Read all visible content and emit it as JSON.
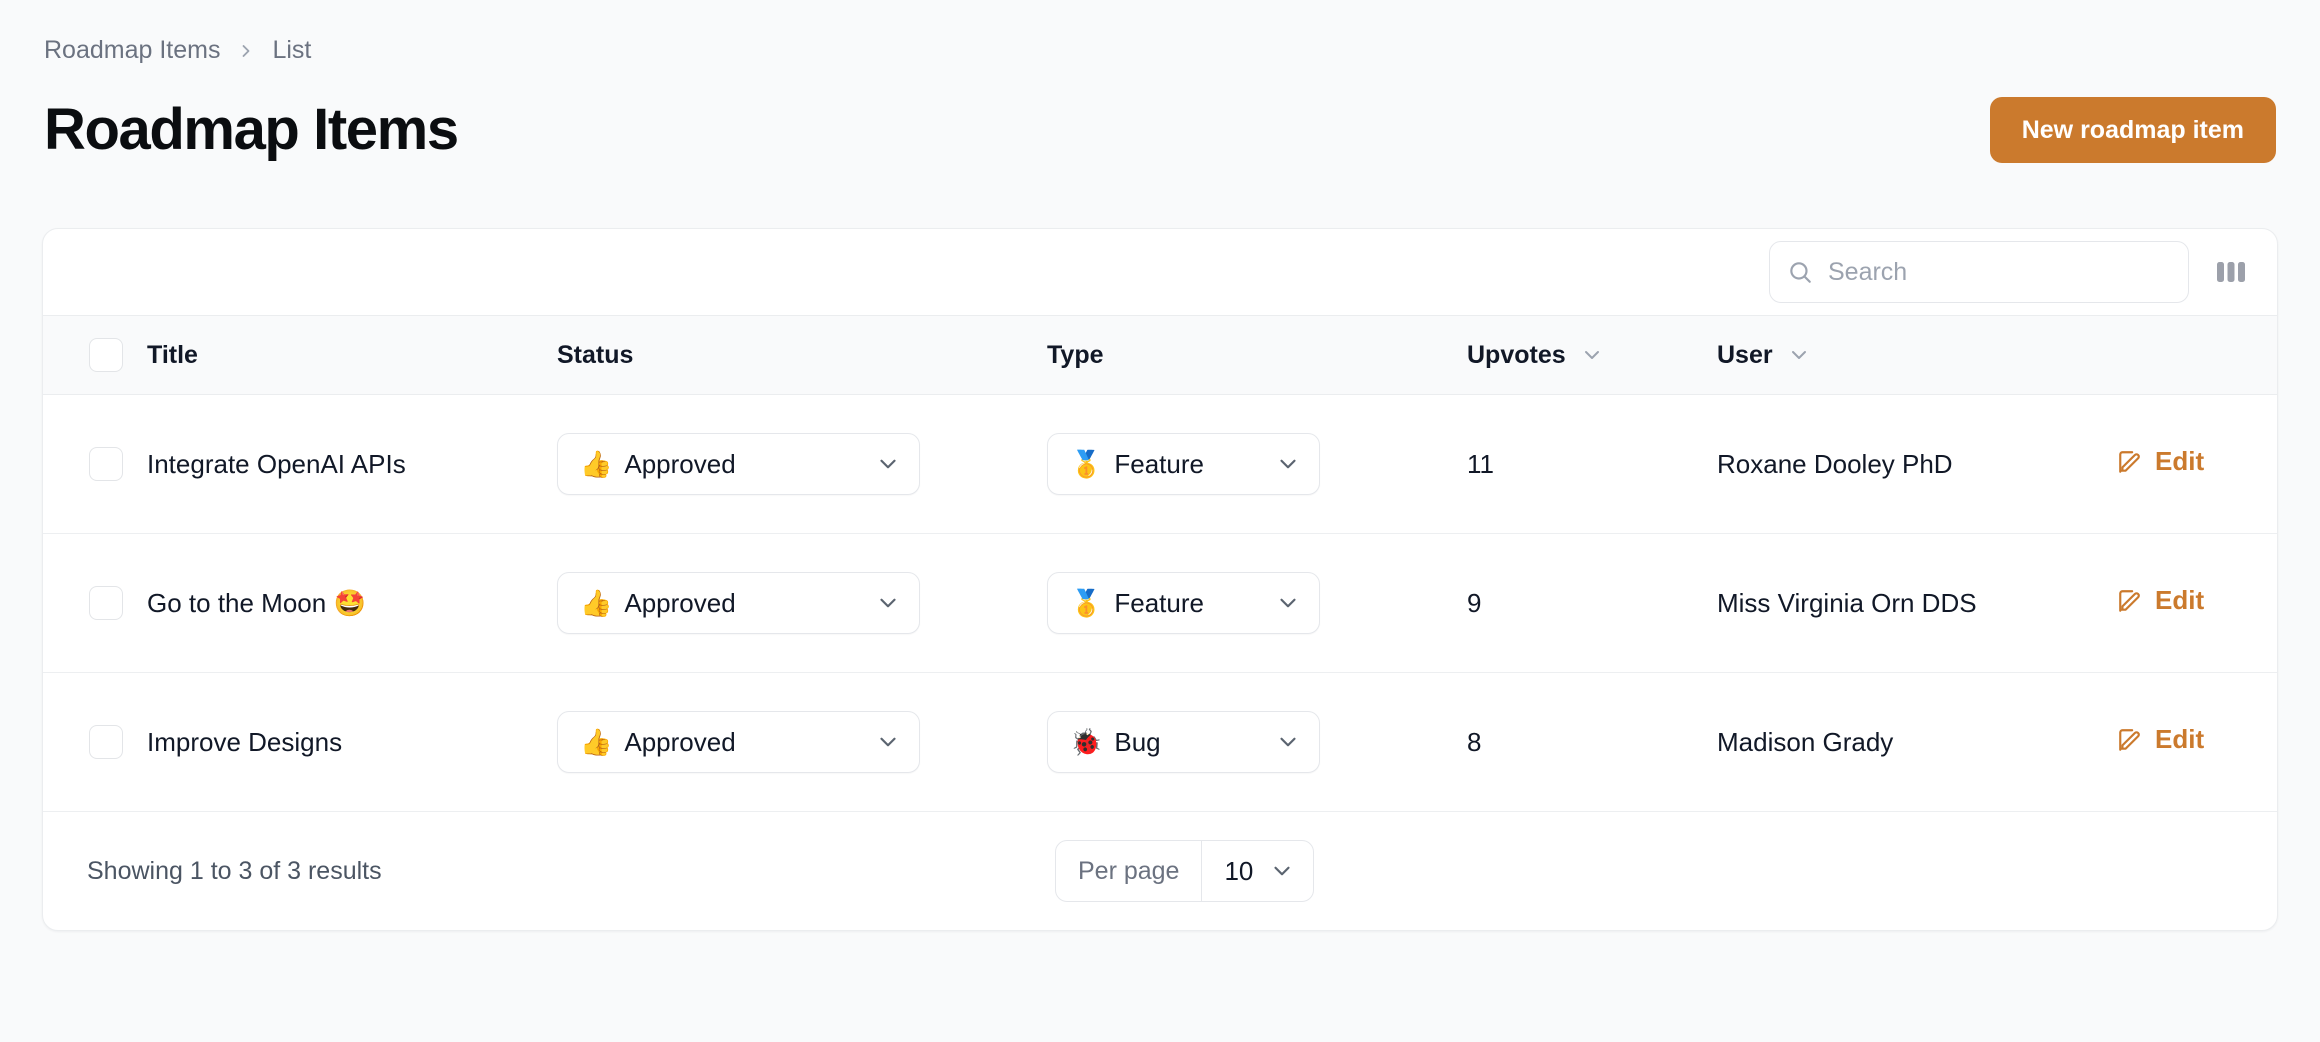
{
  "breadcrumb": {
    "root": "Roadmap Items",
    "separator": "chevron-right-icon",
    "current": "List"
  },
  "header": {
    "title": "Roadmap Items",
    "new_button_label": "New roadmap item"
  },
  "colors": {
    "accent": "#CB7A2D",
    "page_background": "#F9FAFB",
    "card_background": "#FFFFFF",
    "border": "#EBEDEF",
    "muted_text": "#6B7280",
    "text": "#111827"
  },
  "toolbar": {
    "search_placeholder": "Search",
    "search_value": "",
    "search_icon": "search-icon",
    "columns_icon": "columns-toggle-icon"
  },
  "table": {
    "columns": [
      {
        "key": "select",
        "label": "",
        "sortable": false
      },
      {
        "key": "title",
        "label": "Title",
        "sortable": false
      },
      {
        "key": "status",
        "label": "Status",
        "sortable": false
      },
      {
        "key": "type",
        "label": "Type",
        "sortable": false
      },
      {
        "key": "upvotes",
        "label": "Upvotes",
        "sortable": true
      },
      {
        "key": "user",
        "label": "User",
        "sortable": true
      },
      {
        "key": "actions",
        "label": "",
        "sortable": false
      }
    ],
    "rows": [
      {
        "selected": false,
        "title": "Integrate OpenAI APIs",
        "status": {
          "emoji": "👍",
          "label": "Approved"
        },
        "type": {
          "emoji": "🥇",
          "label": "Feature"
        },
        "upvotes": "11",
        "user": "Roxane Dooley PhD",
        "action_label": "Edit"
      },
      {
        "selected": false,
        "title": "Go to the Moon 🤩",
        "status": {
          "emoji": "👍",
          "label": "Approved"
        },
        "type": {
          "emoji": "🥇",
          "label": "Feature"
        },
        "upvotes": "9",
        "user": "Miss Virginia Orn DDS",
        "action_label": "Edit"
      },
      {
        "selected": false,
        "title": "Improve Designs",
        "status": {
          "emoji": "👍",
          "label": "Approved"
        },
        "type": {
          "emoji": "🐞",
          "label": "Bug"
        },
        "upvotes": "8",
        "user": "Madison Grady",
        "action_label": "Edit"
      }
    ]
  },
  "footer": {
    "results_text": "Showing 1 to 3 of 3 results",
    "per_page_label": "Per page",
    "per_page_value": "10"
  }
}
